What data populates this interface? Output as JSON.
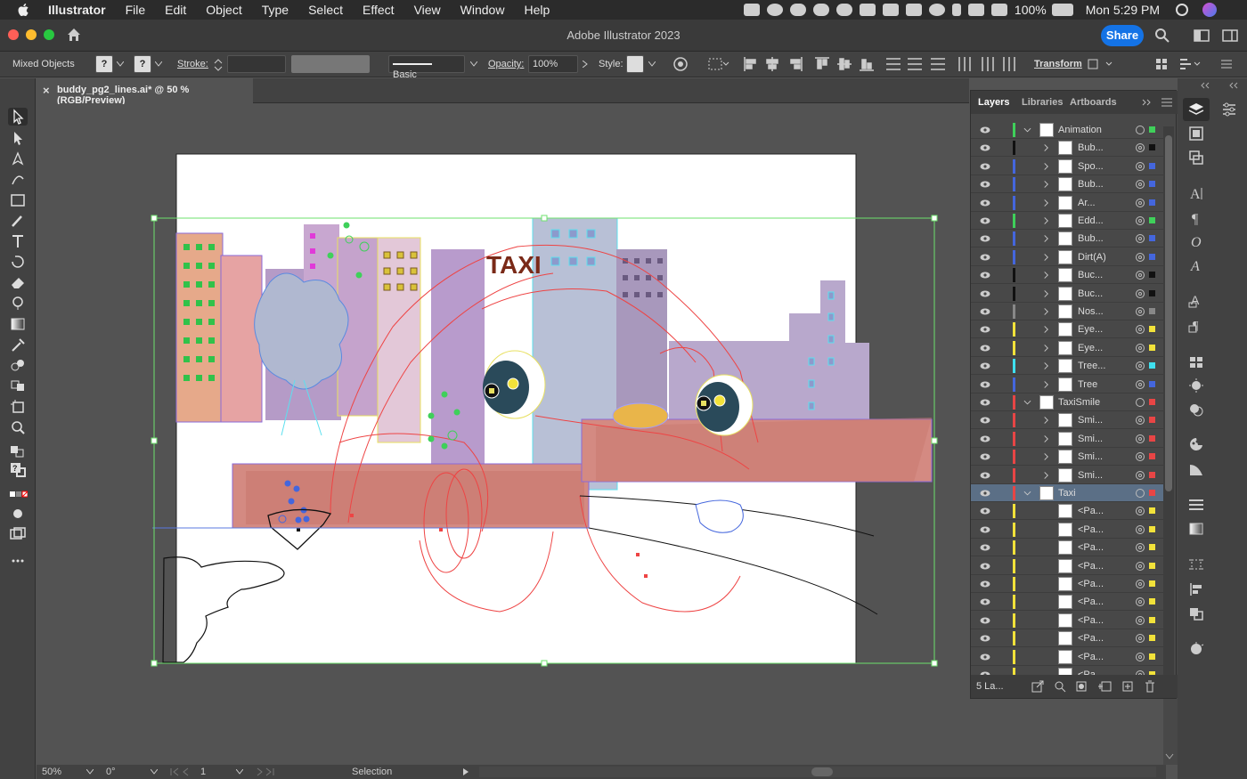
{
  "menubar": {
    "items": [
      "Illustrator",
      "File",
      "Edit",
      "Object",
      "Type",
      "Select",
      "Effect",
      "View",
      "Window",
      "Help"
    ],
    "battery": "100%",
    "clock": "Mon 5:29 PM"
  },
  "window": {
    "title": "Adobe Illustrator 2023",
    "share_label": "Share"
  },
  "control_bar": {
    "selection_label": "Mixed Objects",
    "fill_value": "?",
    "stroke_value": "?",
    "stroke_label": "Stroke:",
    "brush_label": "Basic",
    "opacity_label": "Opacity:",
    "opacity_value": "100%",
    "style_label": "Style:",
    "transform_label": "Transform"
  },
  "document_tab": {
    "title": "buddy_pg2_lines.ai* @ 50 % (RGB/Preview)",
    "close": "×"
  },
  "artwork": {
    "taxi_sign": "TAXI"
  },
  "layers_panel": {
    "tabs": [
      "Layers",
      "Libraries",
      "Artboards"
    ],
    "rows": [
      {
        "name": "Animation",
        "level": 0,
        "expanded": true,
        "color": "#3fd05a"
      },
      {
        "name": "Bub...",
        "level": 1,
        "color": "#111111"
      },
      {
        "name": "Spo...",
        "level": 1,
        "color": "#4466dd"
      },
      {
        "name": "Bub...",
        "level": 1,
        "color": "#4466dd"
      },
      {
        "name": "Ar...",
        "level": 1,
        "color": "#4466dd"
      },
      {
        "name": "Edd...",
        "level": 1,
        "color": "#3fd05a"
      },
      {
        "name": "Bub...",
        "level": 1,
        "color": "#4466dd"
      },
      {
        "name": "Dirt(A)",
        "level": 1,
        "color": "#4466dd"
      },
      {
        "name": "Buc...",
        "level": 1,
        "color": "#111111"
      },
      {
        "name": "Buc...",
        "level": 1,
        "color": "#111111"
      },
      {
        "name": "Nos...",
        "level": 1,
        "color": "#888888"
      },
      {
        "name": "Eye...",
        "level": 1,
        "color": "#f2e23a"
      },
      {
        "name": "Eye...",
        "level": 1,
        "color": "#f2e23a"
      },
      {
        "name": "Tree...",
        "level": 1,
        "color": "#3fe0ef"
      },
      {
        "name": "Tree",
        "level": 1,
        "color": "#4466dd"
      },
      {
        "name": "TaxiSmile",
        "level": 0,
        "expanded": true,
        "color": "#e84545"
      },
      {
        "name": "Smi...",
        "level": 1,
        "color": "#e84545"
      },
      {
        "name": "Smi...",
        "level": 1,
        "color": "#e84545"
      },
      {
        "name": "Smi...",
        "level": 1,
        "color": "#e84545"
      },
      {
        "name": "Smi...",
        "level": 1,
        "color": "#e84545"
      },
      {
        "name": "Taxi",
        "level": 0,
        "expanded": true,
        "selected": true,
        "color": "#e84545"
      },
      {
        "name": "<Pa...",
        "level": 2,
        "color": "#f2e23a"
      },
      {
        "name": "<Pa...",
        "level": 2,
        "color": "#f2e23a"
      },
      {
        "name": "<Pa...",
        "level": 2,
        "color": "#f2e23a"
      },
      {
        "name": "<Pa...",
        "level": 2,
        "color": "#f2e23a"
      },
      {
        "name": "<Pa...",
        "level": 2,
        "color": "#f2e23a"
      },
      {
        "name": "<Pa...",
        "level": 2,
        "color": "#f2e23a"
      },
      {
        "name": "<Pa...",
        "level": 2,
        "color": "#f2e23a"
      },
      {
        "name": "<Pa...",
        "level": 2,
        "color": "#f2e23a"
      },
      {
        "name": "<Pa...",
        "level": 2,
        "color": "#f2e23a"
      },
      {
        "name": "<Pa...",
        "level": 2,
        "color": "#f2e23a"
      }
    ],
    "footer_count": "5 La..."
  },
  "status_bar": {
    "zoom": "50%",
    "rotation": "0°",
    "artboard": "1",
    "tool": "Selection"
  }
}
